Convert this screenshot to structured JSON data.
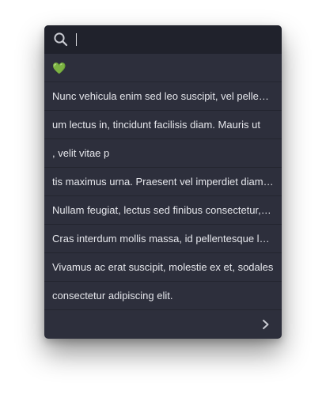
{
  "search": {
    "value": "",
    "placeholder": ""
  },
  "items": [
    {
      "label": "💚"
    },
    {
      "label": "Nunc vehicula enim sed leo suscipit, vel pellentesque"
    },
    {
      "label": "um lectus in, tincidunt facilisis diam. Mauris ut"
    },
    {
      "label": ", velit vitae p"
    },
    {
      "label": "tis maximus urna. Praesent vel imperdiet diam. Donec"
    },
    {
      "label": "Nullam feugiat, lectus sed finibus consectetur, do"
    },
    {
      "label": "Cras interdum mollis massa, id pellentesque lectus"
    },
    {
      "label": "Vivamus ac erat suscipit, molestie ex et, sodales"
    },
    {
      "label": "consectetur adipiscing elit."
    }
  ],
  "icons": {
    "search": "search-icon",
    "next": "chevron-right-icon"
  },
  "colors": {
    "panel_bg": "#2d2f3c",
    "search_bg": "#20222c",
    "text": "#e6e7ec",
    "divider": "#23252f"
  }
}
